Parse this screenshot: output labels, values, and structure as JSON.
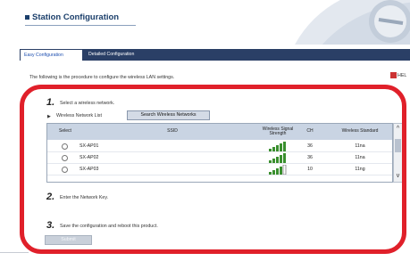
{
  "header": {
    "title": "Station Configuration"
  },
  "tabs": [
    {
      "label": "Easy Configuration",
      "active": true
    },
    {
      "label": "Detailed Configuration",
      "active": false
    }
  ],
  "intro_text": "The following is the procedure to configure the wireless LAN settings.",
  "help_label": "HEL",
  "steps": [
    {
      "number": "1.",
      "text": "Select a wireless network."
    },
    {
      "number": "2.",
      "text": "Enter the Network Key."
    },
    {
      "number": "3.",
      "text": "Save the configuration and reboot this product."
    }
  ],
  "wireless_list": {
    "arrow": "▶",
    "label": "Wireless Network List",
    "search_button": "Search Wireless Networks"
  },
  "table": {
    "headers": {
      "select": "Select",
      "ssid": "SSID",
      "signal": "Wireless Signal Strength",
      "ch": "CH",
      "standard": "Wireless Standard"
    },
    "rows": [
      {
        "ssid": "SX-AP01",
        "signal_bars": 5,
        "ch": "36",
        "standard": "11na"
      },
      {
        "ssid": "SX-AP02",
        "signal_bars": 5,
        "ch": "36",
        "standard": "11na"
      },
      {
        "ssid": "SX-AP03",
        "signal_bars": 4,
        "ch": "10",
        "standard": "11ng"
      }
    ]
  },
  "scroll": {
    "up": "^",
    "down": "v"
  },
  "submit_label": "Submit",
  "colors": {
    "tab_bar": "#2a3f66",
    "title": "#1b3f6b",
    "header_row": "#c9d4e3",
    "signal_green": "#3a8f2e",
    "highlight": "#e0202a"
  }
}
